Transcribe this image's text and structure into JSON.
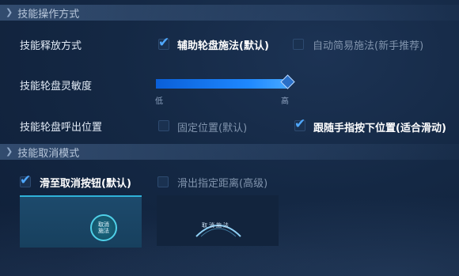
{
  "sections": {
    "operation_title": "技能操作方式",
    "cancel_title": "技能取消模式"
  },
  "release_mode": {
    "label": "技能释放方式",
    "option1": "辅助轮盘施法(默认)",
    "option2": "自动简易施法(新手推荐)",
    "option1_checked": true,
    "option2_checked": false
  },
  "sensitivity": {
    "label": "技能轮盘灵敏度",
    "low": "低",
    "high": "高",
    "level": 1.0
  },
  "wheel_position": {
    "label": "技能轮盘呼出位置",
    "option1": "固定位置(默认)",
    "option2": "跟随手指按下位置(适合滑动)",
    "option1_checked": false,
    "option2_checked": true
  },
  "cancel_mode": {
    "option1": "滑至取消按钮(默认)",
    "option2": "滑出指定距离(高级)",
    "option1_checked": true,
    "option2_checked": false,
    "preview1_button": "取消施法",
    "preview2_arc": "取消施法"
  },
  "colors": {
    "accent": "#1e88ff",
    "check": "#4fa8ff"
  }
}
